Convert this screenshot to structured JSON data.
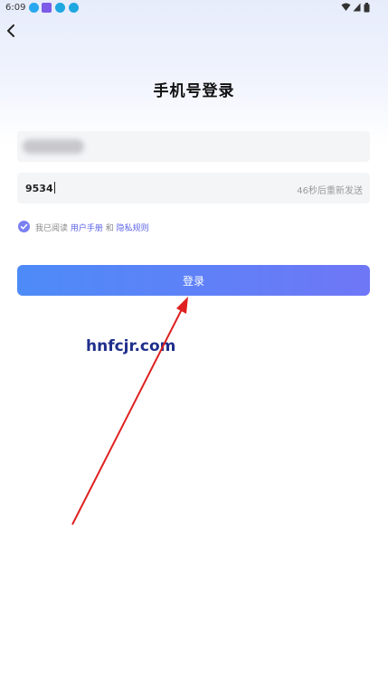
{
  "status_bar": {
    "time": "6:09",
    "left_icons": [
      "qq-icon",
      "calendar-app-icon",
      "download-icon",
      "download-icon"
    ],
    "right_icons": [
      "wifi-icon",
      "signal-icon",
      "battery-icon"
    ]
  },
  "header": {
    "title": "手机号登录"
  },
  "form": {
    "phone_value": "",
    "code_value": "9534",
    "resend_countdown": "46秒后重新发送"
  },
  "agreement": {
    "checked": true,
    "prefix": "我已阅读",
    "user_manual": "用户手册",
    "and": "和",
    "privacy_rules": "隐私规则"
  },
  "login_button_label": "登录",
  "watermark": "hnfcjr.com",
  "colors": {
    "accent": "#6f77f7",
    "button_start": "#4d8bf8",
    "arrow": "#e02020",
    "watermark": "#1f2f8c"
  }
}
